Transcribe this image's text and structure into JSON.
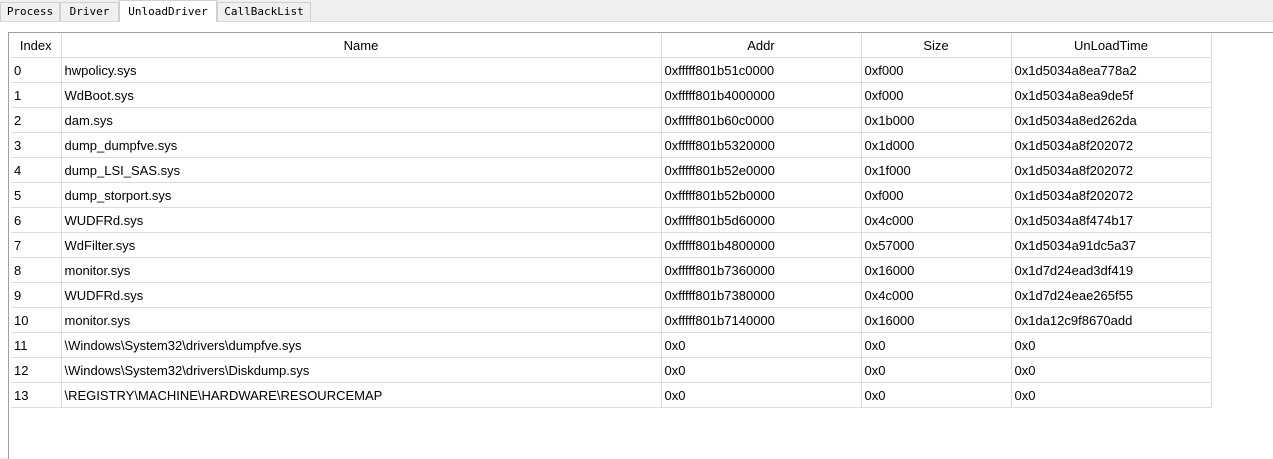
{
  "tabs": [
    {
      "label": "Process",
      "active": false
    },
    {
      "label": "Driver",
      "active": false
    },
    {
      "label": "UnloadDriver",
      "active": true
    },
    {
      "label": "CallBackList",
      "active": false
    }
  ],
  "table": {
    "headers": [
      "Index",
      "Name",
      "Addr",
      "Size",
      "UnLoadTime"
    ],
    "rows": [
      [
        "0",
        "hwpolicy.sys",
        "0xfffff801b51c0000",
        "0xf000",
        "0x1d5034a8ea778a2"
      ],
      [
        "1",
        "WdBoot.sys",
        "0xfffff801b4000000",
        "0xf000",
        "0x1d5034a8ea9de5f"
      ],
      [
        "2",
        "dam.sys",
        "0xfffff801b60c0000",
        "0x1b000",
        "0x1d5034a8ed262da"
      ],
      [
        "3",
        "dump_dumpfve.sys",
        "0xfffff801b5320000",
        "0x1d000",
        "0x1d5034a8f202072"
      ],
      [
        "4",
        "dump_LSI_SAS.sys",
        "0xfffff801b52e0000",
        "0x1f000",
        "0x1d5034a8f202072"
      ],
      [
        "5",
        "dump_storport.sys",
        "0xfffff801b52b0000",
        "0xf000",
        "0x1d5034a8f202072"
      ],
      [
        "6",
        "WUDFRd.sys",
        "0xfffff801b5d60000",
        "0x4c000",
        "0x1d5034a8f474b17"
      ],
      [
        "7",
        "WdFilter.sys",
        "0xfffff801b4800000",
        "0x57000",
        "0x1d5034a91dc5a37"
      ],
      [
        "8",
        "monitor.sys",
        "0xfffff801b7360000",
        "0x16000",
        "0x1d7d24ead3df419"
      ],
      [
        "9",
        "WUDFRd.sys",
        "0xfffff801b7380000",
        "0x4c000",
        "0x1d7d24eae265f55"
      ],
      [
        "10",
        "monitor.sys",
        "0xfffff801b7140000",
        "0x16000",
        "0x1da12c9f8670add"
      ],
      [
        "11",
        "\\Windows\\System32\\drivers\\dumpfve.sys",
        "0x0",
        "0x0",
        "0x0"
      ],
      [
        "12",
        "\\Windows\\System32\\drivers\\Diskdump.sys",
        "0x0",
        "0x0",
        "0x0"
      ],
      [
        "13",
        "\\REGISTRY\\MACHINE\\HARDWARE\\RESOURCEMAP",
        "0x0",
        "0x0",
        "0x0"
      ]
    ]
  }
}
